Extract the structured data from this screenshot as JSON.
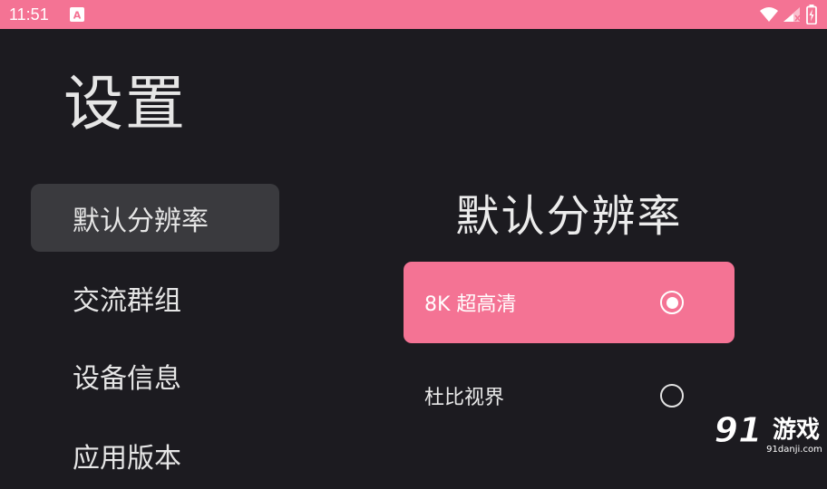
{
  "status_bar": {
    "time": "11:51",
    "notify_letter": "A",
    "bg_color": "#f47394"
  },
  "page": {
    "title": "设置"
  },
  "sidebar": {
    "items": [
      {
        "label": "默认分辨率",
        "active": true
      },
      {
        "label": "交流群组",
        "active": false
      },
      {
        "label": "设备信息",
        "active": false
      },
      {
        "label": "应用版本",
        "active": false
      }
    ]
  },
  "content": {
    "section_title": "默认分辨率",
    "options": [
      {
        "label": "8K 超高清",
        "selected": true
      },
      {
        "label": "杜比视界",
        "selected": false
      }
    ]
  },
  "watermark": {
    "logo_number": "91",
    "logo_text": "游戏",
    "site": "91danji.com"
  },
  "colors": {
    "accent": "#f47394",
    "background": "#1c1b20",
    "sidebar_active": "#3a3a3e"
  }
}
